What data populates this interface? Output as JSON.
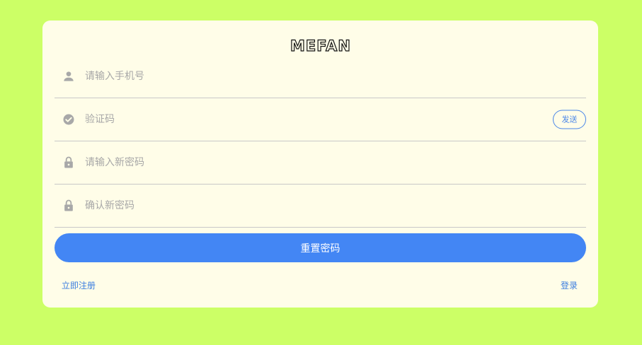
{
  "brand": {
    "logo_text": "MEFAN"
  },
  "form": {
    "phone": {
      "placeholder": "请输入手机号",
      "icon": "user-icon"
    },
    "code": {
      "placeholder": "验证码",
      "icon": "check-circle-icon",
      "send_label": "发送"
    },
    "new_password": {
      "placeholder": "请输入新密码",
      "icon": "lock-icon"
    },
    "confirm_password": {
      "placeholder": "确认新密码",
      "icon": "lock-icon"
    },
    "submit_label": "重置密码"
  },
  "links": {
    "register": "立即注册",
    "login": "登录"
  },
  "colors": {
    "page_background": "#ccff66",
    "card_background": "#fffde8",
    "accent": "#4386f4",
    "icon": "#a8a8a8"
  }
}
